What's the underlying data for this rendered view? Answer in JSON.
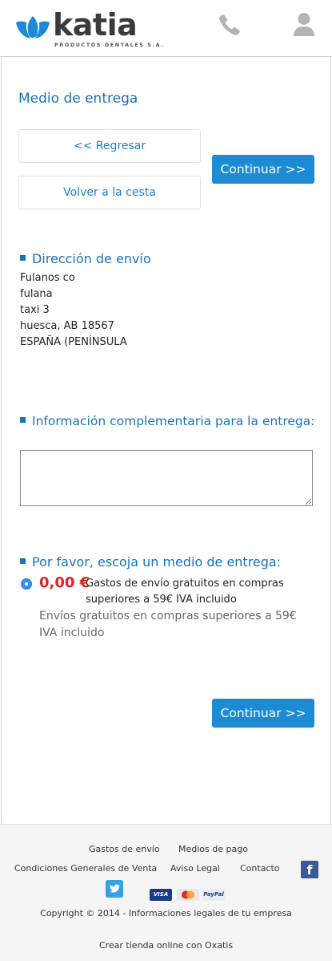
{
  "header": {
    "brand_name": "katia",
    "brand_tagline": "PRODUCTOS DENTALES S.A.",
    "phone_icon": "phone-icon",
    "user_icon": "user-icon"
  },
  "page": {
    "title": "Medio de entrega",
    "back_label": "<< Regresar",
    "cart_label": "Volver a la cesta",
    "continue_label": "Continuar >>"
  },
  "address_section": {
    "heading": "Dirección de envío",
    "lines": [
      "Fulanos co",
      "fulana",
      "taxi 3",
      "huesca, AB 18567",
      "ESPAÑA (PENÍNSULA"
    ]
  },
  "info_section": {
    "heading": "Información complementaria para la entrega:",
    "notes_value": ""
  },
  "delivery_section": {
    "heading": "Por favor, escoja un medio de entrega:",
    "option": {
      "selected": true,
      "price": "0,00 €",
      "description": "Gastos de envío gratuitos en compras superiores a 59€ IVA incluido",
      "note": "Envíos gratuitos en compras superiores a 59€ IVA incluido"
    }
  },
  "footer": {
    "links": {
      "shipping": "Gastos de envío",
      "payment": "Medios de pago",
      "terms": "Condiciones Generales de Venta",
      "legal": "Aviso Legal",
      "contact": "Contacto"
    },
    "social": [
      "facebook-icon",
      "twitter-icon"
    ],
    "payment_methods": {
      "visa": "VISA",
      "mastercard": "MasterCard",
      "paypal": "PayPal"
    },
    "copyright": "Copyright © 2014 - Informaciones legales de tu empresa",
    "credit": "Crear tienda online con Oxatis"
  },
  "colors": {
    "accent": "#1b72b8",
    "button": "#1c8bd3",
    "price": "#e32020"
  }
}
